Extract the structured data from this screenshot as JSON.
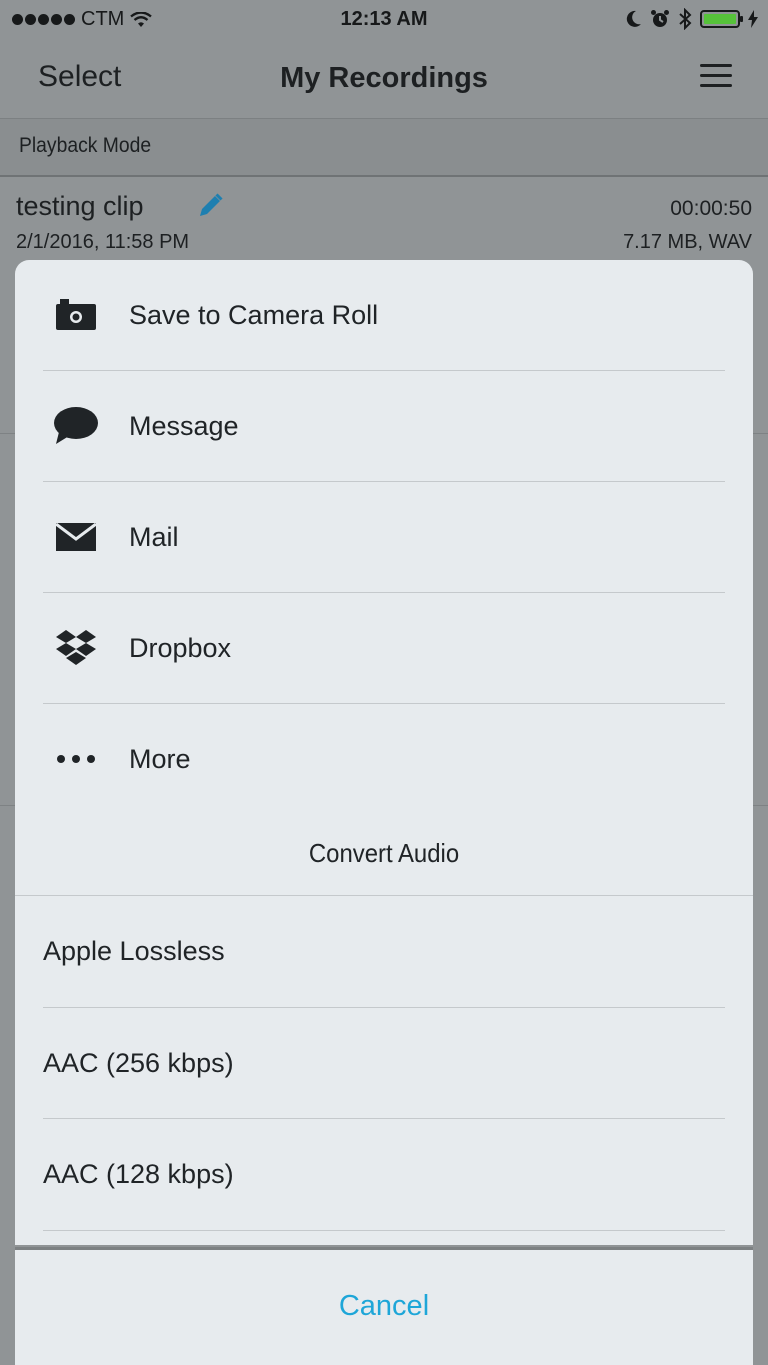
{
  "status_bar": {
    "carrier": "CTM",
    "time": "12:13 AM",
    "battery_color": "#56c23a"
  },
  "nav": {
    "select_label": "Select",
    "title": "My Recordings",
    "menu_icon": "hamburger-menu-icon"
  },
  "playback_mode_label": "Playback Mode",
  "recording": {
    "name": "testing clip",
    "date": "2/1/2016, 11:58 PM",
    "duration": "00:00:50",
    "size_format": "7.17 MB, WAV",
    "edit_icon": "pencil-icon",
    "edit_icon_color": "#1e7fb0"
  },
  "share_actions": [
    {
      "label": "Save to Camera Roll",
      "icon": "camera-icon"
    },
    {
      "label": "Message",
      "icon": "speech-bubble-icon"
    },
    {
      "label": "Mail",
      "icon": "envelope-icon"
    },
    {
      "label": "Dropbox",
      "icon": "dropbox-icon"
    },
    {
      "label": "More",
      "icon": "more-dots-icon"
    }
  ],
  "convert_title": "Convert Audio",
  "convert_formats": [
    {
      "label": "Apple Lossless"
    },
    {
      "label": "AAC (256 kbps)"
    },
    {
      "label": "AAC (128 kbps)"
    }
  ],
  "cancel_label": "Cancel",
  "cancel_color": "#1ea6d8"
}
